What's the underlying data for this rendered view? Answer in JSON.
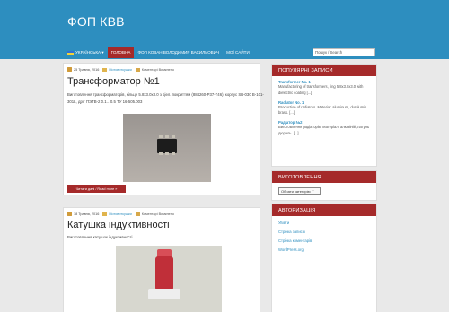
{
  "site": {
    "title": "ФОП КВВ"
  },
  "nav": {
    "items": [
      {
        "label": "УКРАЇНСЬКА ▾",
        "active": false,
        "flag": true
      },
      {
        "label": "ГОЛОВНА",
        "active": true
      },
      {
        "label": "ФОП КОВАН ВОЛОДИМИР ВАСИЛЬОВИЧ",
        "active": false
      },
      {
        "label": "МОЇ САЙТИ",
        "active": false
      }
    ],
    "search_placeholder": "Пошук / Search"
  },
  "posts": [
    {
      "date": "25 Травня, 2016",
      "category": "Мотовиткушки",
      "comments": "Коментарі Вимкнено",
      "title": "Трансформатор №1",
      "excerpt": "Виготовлення трансформаторів, кільце 5.8x3.0x3.0 з діел. покриттям (884260-Р37-Т46), корпус SB-030 В-101-301L, дріт ПЭТВ-2 0.1…0.5 ТУ 16-505.003",
      "read_more": "Читати далі / Read more »"
    },
    {
      "date": "18 Травня, 2016",
      "category": "Мотовиткушки",
      "comments": "Коментарі Вимкнено",
      "title": "Катушка індуктивності",
      "excerpt": "Виготовлення катушок індуктивності"
    }
  ],
  "sidebar": {
    "popular_title": "ПОПУЛЯРНІ ЗАПИСИ",
    "popular": [
      {
        "title": "Transformer No. 1",
        "text": "Manufacturing of transformers, ring 5.8x3.0x3.0 with dielectric coating [...]"
      },
      {
        "title": "Radiator No. 1",
        "text": "Production of radiators. Material: aluminum, duralumin brass. [...]"
      },
      {
        "title": "Радіатор №2",
        "text": "Виготовлення радіаторів. Матеріал: алюміній, латунь дюраль. [...]"
      }
    ],
    "products_title": "ВИГОТОВЛЕННЯ",
    "category_select": "Обрати категорію",
    "auth_title": "АВТОРИЗАЦІЯ",
    "meta_links": [
      "Увійти",
      "Стрічка записів",
      "Стрічка коментарів",
      "WordPress.org"
    ]
  },
  "colors": {
    "header": "#2d8ebf",
    "accent": "#a52a2a",
    "link": "#2d8ebf"
  }
}
